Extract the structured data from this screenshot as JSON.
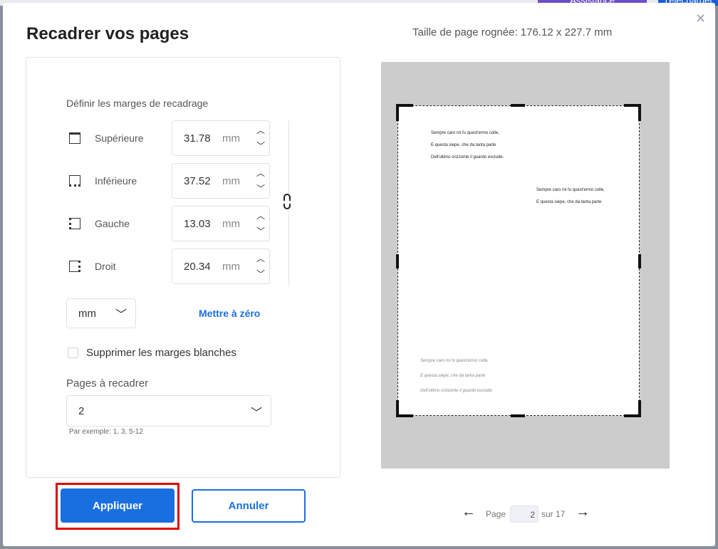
{
  "background": {
    "button1": "Assistance",
    "button2": "Télécharger"
  },
  "dialog": {
    "title": "Recadrer vos pages",
    "crop_size_label": "Taille de page rognée: 176.12 x 227.7 mm"
  },
  "margins": {
    "section_label": "Définir les marges de recadrage",
    "rows": [
      {
        "label": "Supérieure",
        "value": "31.78",
        "unit": "mm"
      },
      {
        "label": "Inférieure",
        "value": "37.52",
        "unit": "mm"
      },
      {
        "label": "Gauche",
        "value": "13.03",
        "unit": "mm"
      },
      {
        "label": "Droit",
        "value": "20.34",
        "unit": "mm"
      }
    ]
  },
  "unit_select": {
    "value": "mm"
  },
  "reset_link": "Mettre à zéro",
  "remove_blank": {
    "label": "Supprimer les marges blanches",
    "checked": false
  },
  "pages": {
    "label": "Pages à recadrer",
    "value": "2",
    "hint": "Par exemple: 1, 3, 5-12"
  },
  "buttons": {
    "apply": "Appliquer",
    "cancel": "Annuler"
  },
  "preview": {
    "block1": [
      "Sempre caro mi fu quest'ermo colle,",
      "E questa siepe, che da tanta parte",
      "Dell'ultimo orizzonte il guardo esclude."
    ],
    "block2": [
      "Sempre caro mi fu quest'ermo colle,",
      "E questa siepe, che da tanta parte"
    ],
    "block3": [
      "Sempre caro mi fu quest'ermo colle,",
      "E questa siepe, che da tanta parte",
      "Dell'ultimo orizzonte il guardo esclude."
    ]
  },
  "pager": {
    "page_label": "Page",
    "current": "2",
    "of_label": "sur 17"
  },
  "icons": {
    "close": "close-icon",
    "up": "chevron-up-icon",
    "down": "chevron-down-icon",
    "link": "link-icon",
    "prev": "arrow-left-icon",
    "next": "arrow-right-icon"
  },
  "colors": {
    "accent": "#1a6fe0",
    "highlight": "#e00000"
  }
}
